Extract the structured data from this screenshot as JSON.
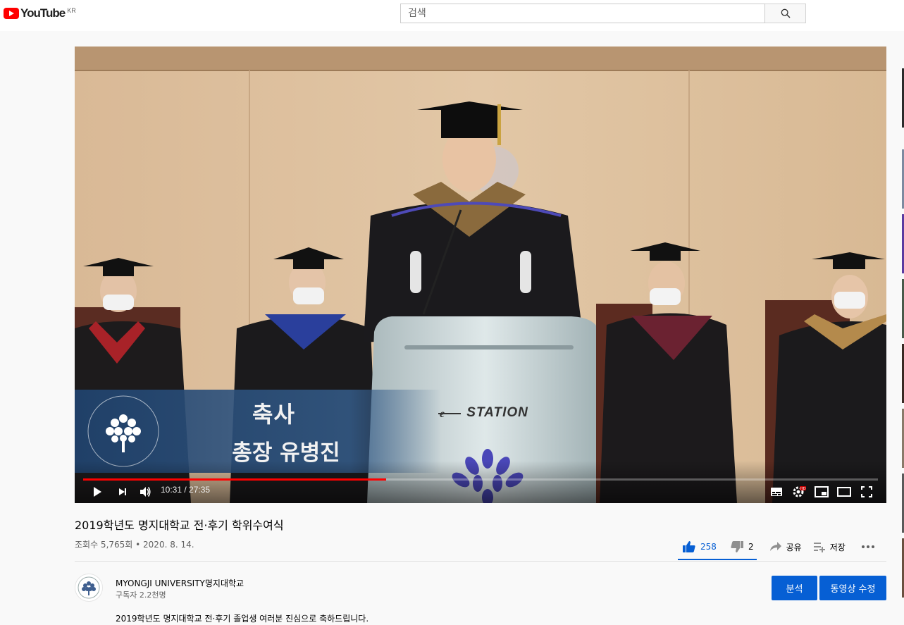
{
  "header": {
    "logo_text": "YouTube",
    "country_code": "KR",
    "search_placeholder": "검색"
  },
  "player": {
    "overlay_title": "축사",
    "overlay_subtitle": "총장 유병진",
    "emblem_text": "MYONGJI UNIVERSITY",
    "emblem_korean": "명지대학교",
    "podium_text": "STATION",
    "current_time": "10:31",
    "duration": "27:35",
    "time_display": "10:31 / 27:35",
    "progress_fraction": 0.381
  },
  "video": {
    "title": "2019학년도 명지대학교 전·후기 학위수여식",
    "views_date": "조회수 5,765회 • 2020. 8. 14.",
    "likes": "258",
    "dislikes": "2",
    "share_label": "공유",
    "save_label": "저장"
  },
  "channel": {
    "name": "MYONGJI UNIVERSITY명지대학교",
    "subscribers": "구독자 2.2천명",
    "analytics_button": "분석",
    "edit_button": "동영상 수정"
  },
  "description": "2019학년도 명지대학교 전·후기 졸업생 여러분 진심으로 축하드립니다.",
  "colors": {
    "accent_blue": "#065fd4",
    "progress_red": "#ff0000",
    "logo_red": "#ff0000"
  }
}
